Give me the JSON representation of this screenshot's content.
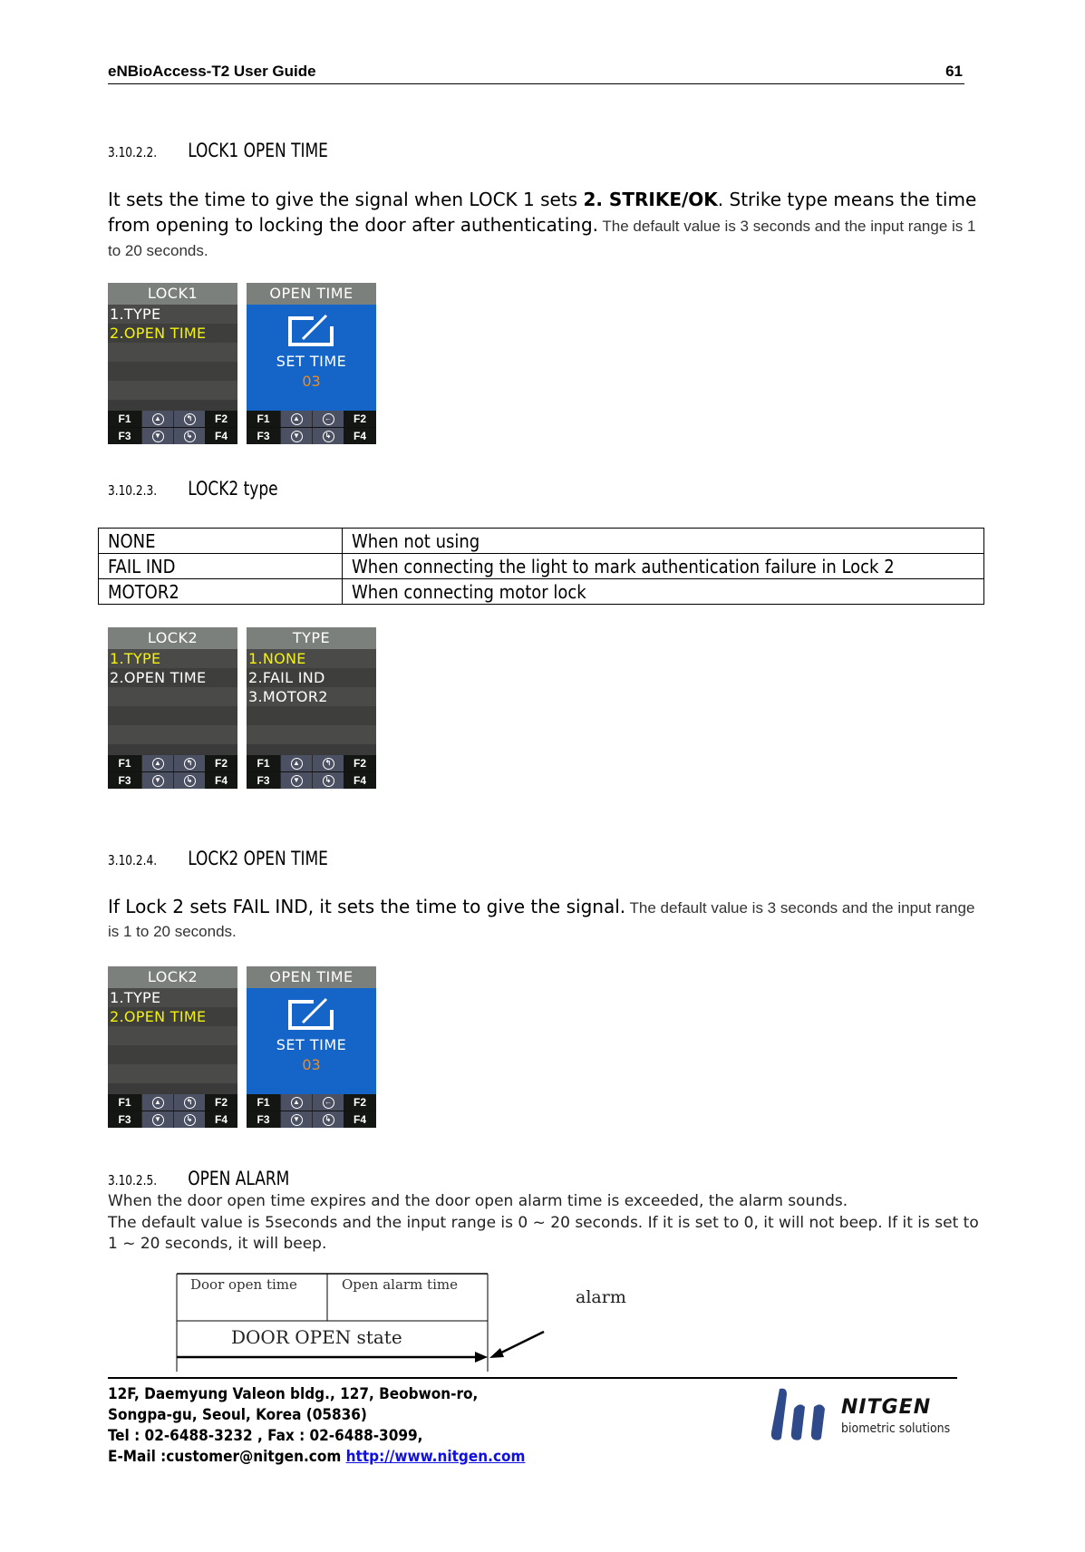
{
  "header": {
    "title": "eNBioAccess-T2 User Guide",
    "page_number": "61"
  },
  "sections": [
    {
      "number": "3.10.2.2.",
      "title": "LOCK1 OPEN TIME",
      "body_large_1": "It sets the time to give the signal when LOCK 1 sets ",
      "body_bold": "2. STRIKE/OK",
      "body_large_2": ". Strike type means the time from opening to locking the door after authenticating.",
      "body_small": " The default value is 3 seconds and the input range is 1 to 20 seconds."
    },
    {
      "number": "3.10.2.3.",
      "title": "LOCK2 type"
    },
    {
      "number": "3.10.2.4.",
      "title": "LOCK2 OPEN TIME",
      "body_large": "If Lock 2 sets FAIL IND, it sets the time to give the signal.",
      "body_small": " The default value is 3 seconds and the input range is 1 to 20 seconds."
    },
    {
      "number": "3.10.2.5.",
      "title": "OPEN ALARM",
      "line1": "When the door open time expires and the door open alarm time is exceeded, the alarm sounds.",
      "line2": "The default value is 5seconds and the input range is 0 ~ 20 seconds. If it is set to 0, it will not beep. If it is set to 1 ~ 20 seconds, it will beep."
    }
  ],
  "lock2_table": [
    {
      "type": "NONE",
      "desc": "When not using"
    },
    {
      "type": "FAIL IND",
      "desc": "When connecting the light to mark authentication failure in Lock 2"
    },
    {
      "type": "MOTOR2",
      "desc": "When connecting motor lock"
    }
  ],
  "screens": {
    "keys": {
      "f1": "F1",
      "f2": "F2",
      "f3": "F3",
      "f4": "F4"
    },
    "lock1_menu": {
      "title": "LOCK1",
      "items": [
        "1.TYPE",
        "2.OPEN TIME"
      ],
      "selected_index": 1
    },
    "lock1_open_time": {
      "title": "OPEN TIME",
      "label": "SET TIME",
      "value": "03"
    },
    "lock2_menu_a": {
      "title": "LOCK2",
      "items": [
        "1.TYPE",
        "2.OPEN TIME"
      ],
      "selected_index": 0
    },
    "lock2_type": {
      "title": "TYPE",
      "items": [
        "1.NONE",
        "2.FAIL IND",
        "3.MOTOR2"
      ],
      "selected_index": 0
    },
    "lock2_menu_b": {
      "title": "LOCK2",
      "items": [
        "1.TYPE",
        "2.OPEN TIME"
      ],
      "selected_index": 1
    },
    "lock2_open_time": {
      "title": "OPEN TIME",
      "label": "SET TIME",
      "value": "03"
    }
  },
  "diagram": {
    "door_open_time": "Door open time",
    "open_alarm_time": "Open alarm time",
    "door_open_state": "DOOR OPEN state",
    "alarm": "alarm"
  },
  "footer": {
    "address1": "12F, Daemyung Valeon bldg., 127, Beobwon-ro,",
    "address2": "Songpa-gu, Seoul, Korea (05836)",
    "phone": "Tel : 02-6488-3232 , Fax : 02-6488-3099,",
    "email": "E-Mail :customer@nitgen.com ",
    "website": "http://www.nitgen.com",
    "logo_name": "NITGEN",
    "logo_tagline": "biometric solutions",
    "logo_color": "#2e4a8a"
  }
}
